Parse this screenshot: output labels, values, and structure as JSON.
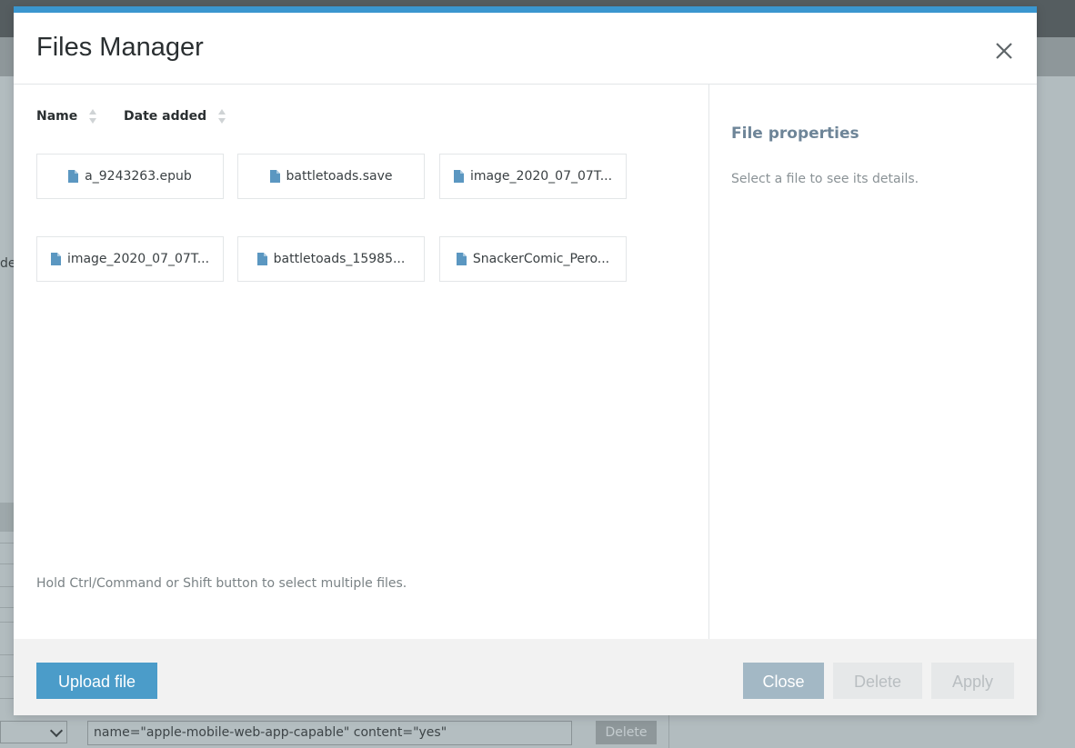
{
  "background": {
    "left_fragment": "de",
    "meta_select_value": "",
    "meta_input_value": "name=\"apple-mobile-web-app-capable\" content=\"yes\"",
    "meta_delete_label": "Delete"
  },
  "modal": {
    "title": "Files Manager",
    "close_icon": "close-icon",
    "accent_color": "#3a96cf",
    "sort": {
      "name_label": "Name",
      "date_label": "Date added"
    },
    "files": [
      {
        "label": "a_9243263.epub"
      },
      {
        "label": "battletoads.save"
      },
      {
        "label": "image_2020_07_07T..."
      },
      {
        "label": "image_2020_07_07T..."
      },
      {
        "label": "battletoads_15985..."
      },
      {
        "label": "SnackerComic_Pero..."
      }
    ],
    "hint": "Hold Ctrl/Command or Shift button to select multiple files.",
    "properties": {
      "title": "File properties",
      "description": "Select a file to see its details."
    },
    "footer": {
      "upload_label": "Upload file",
      "close_label": "Close",
      "delete_label": "Delete",
      "apply_label": "Apply"
    }
  }
}
